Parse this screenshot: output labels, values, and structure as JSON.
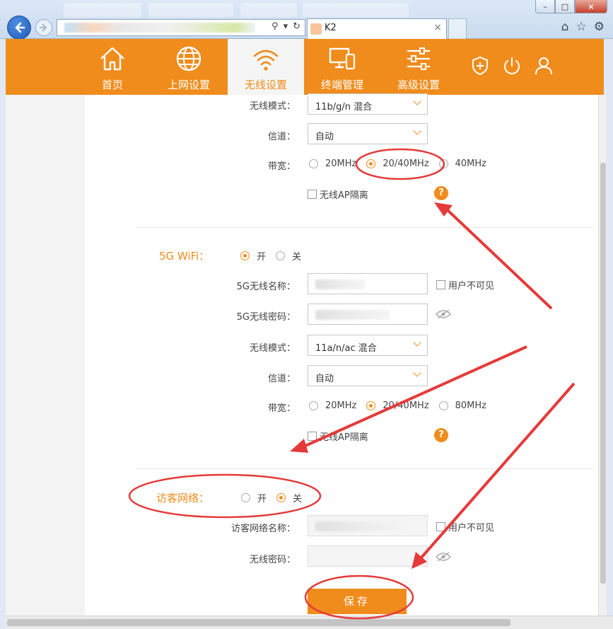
{
  "browser": {
    "tab_title": "K2",
    "tab_close": "×",
    "window_buttons": [
      "–",
      "□",
      "×"
    ],
    "icons": [
      "home-icon",
      "star-icon",
      "gear-icon",
      "back-arrow-icon",
      "forward-arrow-icon",
      "search-icon",
      "refresh-icon"
    ]
  },
  "nav": {
    "items": [
      {
        "label": "首页",
        "icon": "home-icon"
      },
      {
        "label": "上网设置",
        "icon": "globe-icon"
      },
      {
        "label": "无线设置",
        "icon": "wifi-icon",
        "active": true
      },
      {
        "label": "终端管理",
        "icon": "devices-icon"
      },
      {
        "label": "高级设置",
        "icon": "sliders-icon"
      }
    ],
    "tools": [
      "shield-plus-icon",
      "power-icon",
      "user-icon"
    ]
  },
  "wifi24": {
    "mode_label": "无线模式：",
    "mode_value": "11b/g/n 混合",
    "channel_label": "信道：",
    "channel_value": "自动",
    "bandwidth_label": "带宽：",
    "bandwidth_options": [
      "20MHz",
      "20/40MHz",
      "40MHz"
    ],
    "bandwidth_selected": "20/40MHz",
    "ap_isolation": "无线AP隔离",
    "help": "?"
  },
  "wifi5g": {
    "title": "5G WiFi：",
    "toggle_on": "开",
    "toggle_off": "关",
    "enabled": true,
    "name_label": "5G无线名称：",
    "hidden_label": "用户不可见",
    "password_label": "5G无线密码：",
    "mode_label": "无线模式：",
    "mode_value": "11a/n/ac 混合",
    "channel_label": "信道：",
    "channel_value": "自动",
    "bandwidth_label": "带宽：",
    "bandwidth_options": [
      "20MHz",
      "20/40MHz",
      "80MHz"
    ],
    "bandwidth_selected": "20/40MHz",
    "ap_isolation": "无线AP隔离",
    "help": "?"
  },
  "guest": {
    "title": "访客网络：",
    "toggle_on": "开",
    "toggle_off": "关",
    "enabled": false,
    "name_label": "访客网络名称：",
    "hidden_label": "用户不可见",
    "password_label": "无线密码："
  },
  "save_label": "保存",
  "annotation_color": "#e53a3a",
  "accent_color": "#f08c1c"
}
